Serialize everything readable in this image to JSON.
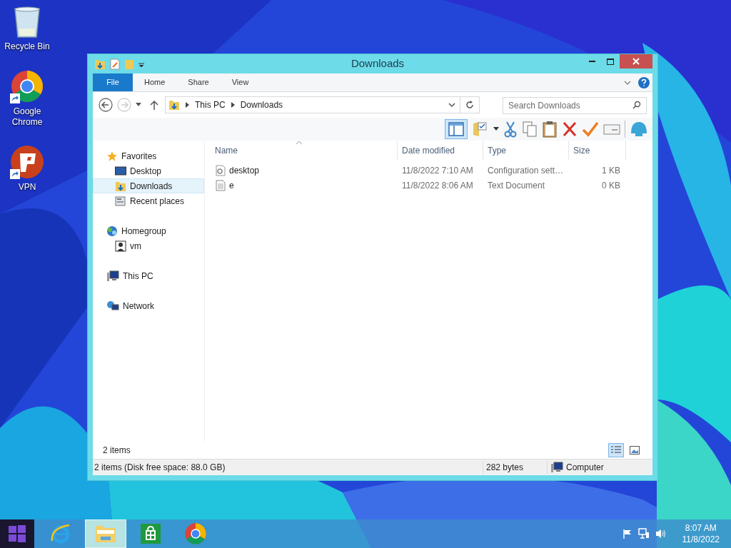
{
  "desktop_icons": [
    {
      "kind": "recycle",
      "label": "Recycle Bin"
    },
    {
      "kind": "chrome",
      "label": "Google Chrome"
    },
    {
      "kind": "vpn",
      "label": "VPN"
    }
  ],
  "window": {
    "title": "Downloads",
    "tabs": [
      {
        "label": "File",
        "selected": true
      },
      {
        "label": "Home",
        "selected": false
      },
      {
        "label": "Share",
        "selected": false
      },
      {
        "label": "View",
        "selected": false
      }
    ],
    "address": [
      "This PC",
      "Downloads"
    ],
    "search": {
      "placeholder": "Search Downloads"
    },
    "nav": [
      {
        "label": "Favorites",
        "kind": "star",
        "selected": false,
        "children": [
          {
            "label": "Desktop",
            "kind": "desktop",
            "selected": false
          },
          {
            "label": "Downloads",
            "kind": "downloads",
            "selected": true
          },
          {
            "label": "Recent places",
            "kind": "recent",
            "selected": false
          }
        ]
      },
      {
        "label": "Homegroup",
        "kind": "homegroup",
        "selected": false,
        "children": [
          {
            "label": "vm",
            "kind": "user",
            "selected": false
          }
        ]
      },
      {
        "label": "This PC",
        "kind": "pc",
        "selected": false
      },
      {
        "label": "Network",
        "kind": "network",
        "selected": false
      }
    ],
    "columns": [
      "Name",
      "Date modified",
      "Type",
      "Size"
    ],
    "rows": [
      {
        "kind": "config",
        "name": "desktop",
        "date": "11/8/2022 7:10 AM",
        "type": "Configuration sett…",
        "size": "1 KB"
      },
      {
        "kind": "text",
        "name": "e",
        "date": "11/8/2022 8:06 AM",
        "type": "Text Document",
        "size": "0 KB"
      }
    ],
    "item_count": "2 items",
    "views": [
      {
        "kind": "details",
        "selected": true
      },
      {
        "kind": "thumbs",
        "selected": false
      }
    ],
    "status_bar": {
      "summary": "2 items (Disk free space: 88.0 GB)",
      "size": "282 bytes",
      "location": "Computer"
    }
  },
  "taskbar": {
    "apps": [
      {
        "kind": "ie",
        "selected": false
      },
      {
        "kind": "explorer",
        "selected": true
      },
      {
        "kind": "store",
        "selected": false
      },
      {
        "kind": "chrome",
        "selected": false
      }
    ],
    "time": "8:07 AM",
    "date": "11/8/2022"
  }
}
